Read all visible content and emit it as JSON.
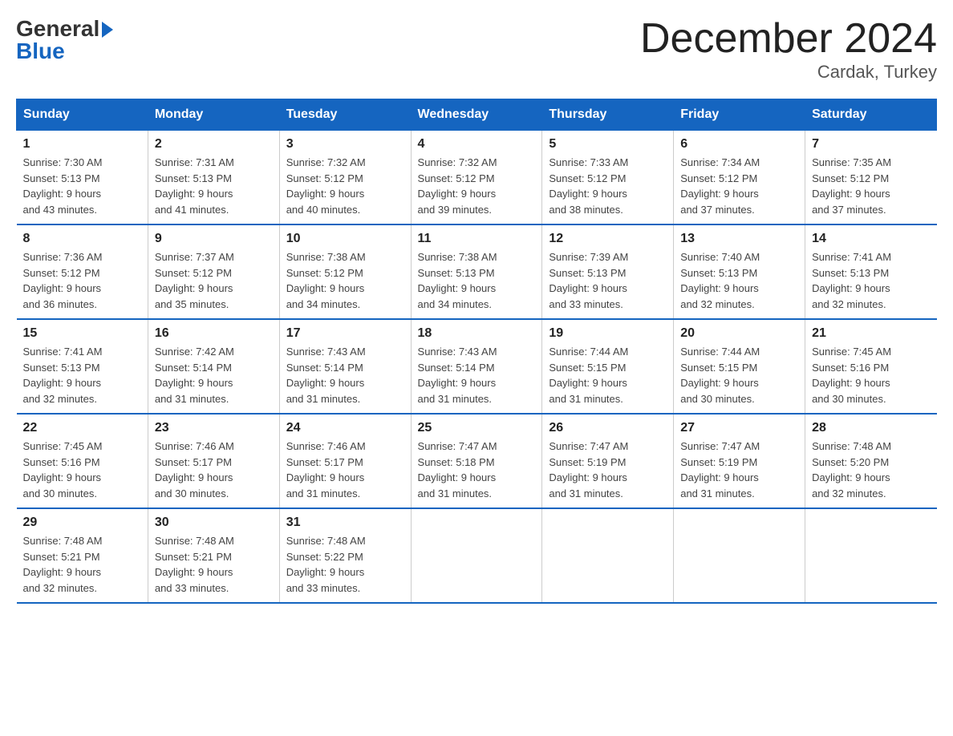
{
  "header": {
    "logo_general": "General",
    "logo_blue": "Blue",
    "title": "December 2024",
    "location": "Cardak, Turkey"
  },
  "days_of_week": [
    "Sunday",
    "Monday",
    "Tuesday",
    "Wednesday",
    "Thursday",
    "Friday",
    "Saturday"
  ],
  "weeks": [
    [
      {
        "day": "1",
        "sunrise": "7:30 AM",
        "sunset": "5:13 PM",
        "daylight": "9 hours and 43 minutes."
      },
      {
        "day": "2",
        "sunrise": "7:31 AM",
        "sunset": "5:13 PM",
        "daylight": "9 hours and 41 minutes."
      },
      {
        "day": "3",
        "sunrise": "7:32 AM",
        "sunset": "5:12 PM",
        "daylight": "9 hours and 40 minutes."
      },
      {
        "day": "4",
        "sunrise": "7:32 AM",
        "sunset": "5:12 PM",
        "daylight": "9 hours and 39 minutes."
      },
      {
        "day": "5",
        "sunrise": "7:33 AM",
        "sunset": "5:12 PM",
        "daylight": "9 hours and 38 minutes."
      },
      {
        "day": "6",
        "sunrise": "7:34 AM",
        "sunset": "5:12 PM",
        "daylight": "9 hours and 37 minutes."
      },
      {
        "day": "7",
        "sunrise": "7:35 AM",
        "sunset": "5:12 PM",
        "daylight": "9 hours and 37 minutes."
      }
    ],
    [
      {
        "day": "8",
        "sunrise": "7:36 AM",
        "sunset": "5:12 PM",
        "daylight": "9 hours and 36 minutes."
      },
      {
        "day": "9",
        "sunrise": "7:37 AM",
        "sunset": "5:12 PM",
        "daylight": "9 hours and 35 minutes."
      },
      {
        "day": "10",
        "sunrise": "7:38 AM",
        "sunset": "5:12 PM",
        "daylight": "9 hours and 34 minutes."
      },
      {
        "day": "11",
        "sunrise": "7:38 AM",
        "sunset": "5:13 PM",
        "daylight": "9 hours and 34 minutes."
      },
      {
        "day": "12",
        "sunrise": "7:39 AM",
        "sunset": "5:13 PM",
        "daylight": "9 hours and 33 minutes."
      },
      {
        "day": "13",
        "sunrise": "7:40 AM",
        "sunset": "5:13 PM",
        "daylight": "9 hours and 32 minutes."
      },
      {
        "day": "14",
        "sunrise": "7:41 AM",
        "sunset": "5:13 PM",
        "daylight": "9 hours and 32 minutes."
      }
    ],
    [
      {
        "day": "15",
        "sunrise": "7:41 AM",
        "sunset": "5:13 PM",
        "daylight": "9 hours and 32 minutes."
      },
      {
        "day": "16",
        "sunrise": "7:42 AM",
        "sunset": "5:14 PM",
        "daylight": "9 hours and 31 minutes."
      },
      {
        "day": "17",
        "sunrise": "7:43 AM",
        "sunset": "5:14 PM",
        "daylight": "9 hours and 31 minutes."
      },
      {
        "day": "18",
        "sunrise": "7:43 AM",
        "sunset": "5:14 PM",
        "daylight": "9 hours and 31 minutes."
      },
      {
        "day": "19",
        "sunrise": "7:44 AM",
        "sunset": "5:15 PM",
        "daylight": "9 hours and 31 minutes."
      },
      {
        "day": "20",
        "sunrise": "7:44 AM",
        "sunset": "5:15 PM",
        "daylight": "9 hours and 30 minutes."
      },
      {
        "day": "21",
        "sunrise": "7:45 AM",
        "sunset": "5:16 PM",
        "daylight": "9 hours and 30 minutes."
      }
    ],
    [
      {
        "day": "22",
        "sunrise": "7:45 AM",
        "sunset": "5:16 PM",
        "daylight": "9 hours and 30 minutes."
      },
      {
        "day": "23",
        "sunrise": "7:46 AM",
        "sunset": "5:17 PM",
        "daylight": "9 hours and 30 minutes."
      },
      {
        "day": "24",
        "sunrise": "7:46 AM",
        "sunset": "5:17 PM",
        "daylight": "9 hours and 31 minutes."
      },
      {
        "day": "25",
        "sunrise": "7:47 AM",
        "sunset": "5:18 PM",
        "daylight": "9 hours and 31 minutes."
      },
      {
        "day": "26",
        "sunrise": "7:47 AM",
        "sunset": "5:19 PM",
        "daylight": "9 hours and 31 minutes."
      },
      {
        "day": "27",
        "sunrise": "7:47 AM",
        "sunset": "5:19 PM",
        "daylight": "9 hours and 31 minutes."
      },
      {
        "day": "28",
        "sunrise": "7:48 AM",
        "sunset": "5:20 PM",
        "daylight": "9 hours and 32 minutes."
      }
    ],
    [
      {
        "day": "29",
        "sunrise": "7:48 AM",
        "sunset": "5:21 PM",
        "daylight": "9 hours and 32 minutes."
      },
      {
        "day": "30",
        "sunrise": "7:48 AM",
        "sunset": "5:21 PM",
        "daylight": "9 hours and 33 minutes."
      },
      {
        "day": "31",
        "sunrise": "7:48 AM",
        "sunset": "5:22 PM",
        "daylight": "9 hours and 33 minutes."
      },
      null,
      null,
      null,
      null
    ]
  ],
  "labels": {
    "sunrise": "Sunrise:",
    "sunset": "Sunset:",
    "daylight": "Daylight:"
  }
}
